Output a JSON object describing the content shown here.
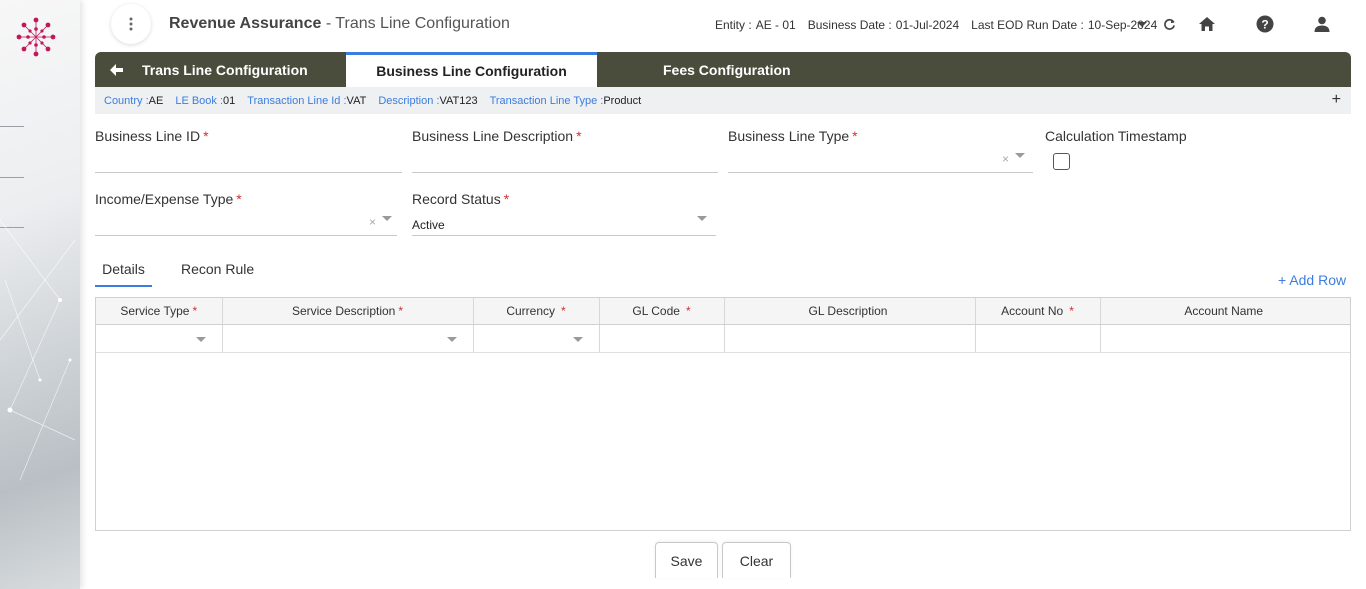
{
  "header": {
    "app_title": "Revenue Assurance",
    "page_title": " - Trans Line Configuration",
    "entity_label": "Entity :",
    "entity_value": "AE - 01",
    "business_date_label": "Business Date :",
    "business_date_value": "01-Jul-2024",
    "eod_label": "Last EOD Run Date :",
    "eod_value": "10-Sep-2024"
  },
  "tabs": [
    {
      "label": "Trans Line Configuration"
    },
    {
      "label": "Business Line Configuration"
    },
    {
      "label": "Fees Configuration"
    }
  ],
  "crumbs": {
    "country_label": "Country :",
    "country_value": "AE",
    "le_book_label": "LE Book :",
    "le_book_value": "01",
    "trans_line_id_label": "Transaction Line Id :",
    "trans_line_id_value": "VAT",
    "description_label": "Description :",
    "description_value": "VAT123",
    "trans_line_type_label": "Transaction Line Type :",
    "trans_line_type_value": "Product",
    "expand_label": "+"
  },
  "form": {
    "business_line_id_label": "Business Line ID",
    "business_line_desc_label": "Business Line Description",
    "business_line_type_label": "Business Line Type",
    "calc_timestamp_label": "Calculation Timestamp",
    "income_expense_label": "Income/Expense Type",
    "record_status_label": "Record Status",
    "record_status_value": "Active",
    "required_mark": "*",
    "clear_glyph": "×"
  },
  "subtabs": [
    {
      "label": "Details"
    },
    {
      "label": "Recon Rule"
    }
  ],
  "add_row_label": "+ Add Row",
  "grid": {
    "columns": [
      {
        "label": "Service Type",
        "required": "*"
      },
      {
        "label": "Service Description",
        "required": "*"
      },
      {
        "label": "Currency",
        "required": "*"
      },
      {
        "label": "GL Code",
        "required": "*"
      },
      {
        "label": "GL Description",
        "required": ""
      },
      {
        "label": "Account No",
        "required": "*"
      },
      {
        "label": "Account Name",
        "required": ""
      }
    ]
  },
  "buttons": {
    "save": "Save",
    "clear": "Clear"
  },
  "colors": {
    "accent": "#3b7de0",
    "tabbar": "#4a4d3c",
    "required": "#d32f2f",
    "logo": "#c2185b"
  },
  "icons": [
    "vertical-dots-icon",
    "caret-down-icon",
    "refresh-icon",
    "home-icon",
    "help-icon",
    "user-icon",
    "back-arrow-icon",
    "plus-icon"
  ]
}
